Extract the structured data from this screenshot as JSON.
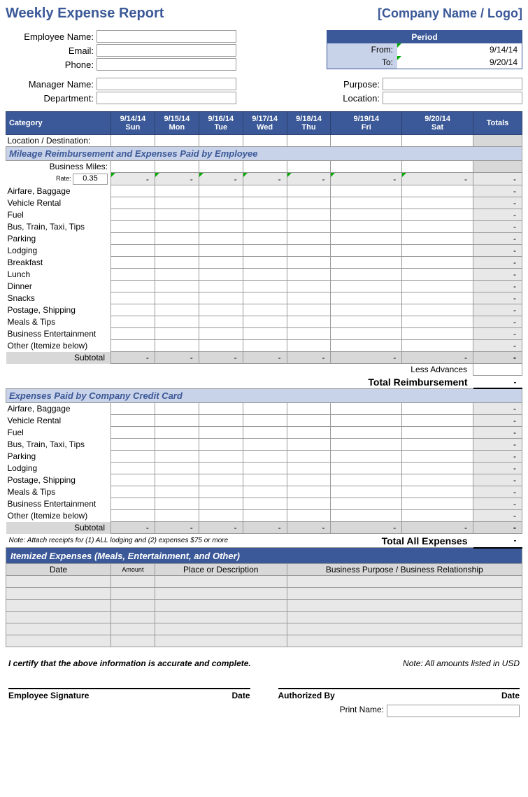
{
  "header": {
    "title": "Weekly Expense Report",
    "company": "[Company Name / Logo]"
  },
  "employee": {
    "name_label": "Employee Name:",
    "email_label": "Email:",
    "phone_label": "Phone:",
    "manager_label": "Manager Name:",
    "department_label": "Department:",
    "purpose_label": "Purpose:",
    "location_label": "Location:"
  },
  "period": {
    "header": "Period",
    "from_label": "From:",
    "to_label": "To:",
    "from": "9/14/14",
    "to": "9/20/14"
  },
  "columns": {
    "category": "Category",
    "totals": "Totals",
    "days": [
      {
        "date": "9/14/14",
        "name": "Sun"
      },
      {
        "date": "9/15/14",
        "name": "Mon"
      },
      {
        "date": "9/16/14",
        "name": "Tue"
      },
      {
        "date": "9/17/14",
        "name": "Wed"
      },
      {
        "date": "9/18/14",
        "name": "Thu"
      },
      {
        "date": "9/19/14",
        "name": "Fri"
      },
      {
        "date": "9/20/14",
        "name": "Sat"
      }
    ]
  },
  "location_dest": "Location / Destination:",
  "section1": {
    "title": "Mileage Reimbursement and Expenses Paid by Employee",
    "miles": "Business Miles:",
    "rate_label": "Rate:",
    "rate": "0.35",
    "rows": [
      "Airfare, Baggage",
      "Vehicle Rental",
      "Fuel",
      "Bus, Train, Taxi, Tips",
      "Parking",
      "Lodging",
      "Breakfast",
      "Lunch",
      "Dinner",
      "Snacks",
      "Postage, Shipping",
      "Meals & Tips",
      "Business Entertainment",
      "Other (Itemize below)"
    ],
    "subtotal": "Subtotal",
    "less_advances": "Less Advances",
    "total_reimb": "Total Reimbursement"
  },
  "section2": {
    "title": "Expenses Paid by Company Credit Card",
    "rows": [
      "Airfare, Baggage",
      "Vehicle Rental",
      "Fuel",
      "Bus, Train, Taxi, Tips",
      "Parking",
      "Lodging",
      "Postage, Shipping",
      "Meals & Tips",
      "Business Entertainment",
      "Other (Itemize below)"
    ],
    "subtotal": "Subtotal",
    "note": "Note:  Attach receipts for (1) ALL lodging and (2) expenses $75 or more",
    "total_all": "Total All Expenses"
  },
  "itemized": {
    "title": "Itemized Expenses (Meals, Entertainment, and Other)",
    "cols": {
      "date": "Date",
      "amount": "Amount",
      "place": "Place or Description",
      "purpose": "Business Purpose / Business Relationship"
    }
  },
  "footer": {
    "certify": "I certify that the above information is accurate and complete.",
    "usd_note": "Note: All amounts listed in USD",
    "emp_sig": "Employee Signature",
    "date": "Date",
    "auth_by": "Authorized By",
    "print_name": "Print Name:"
  },
  "dash": "-"
}
